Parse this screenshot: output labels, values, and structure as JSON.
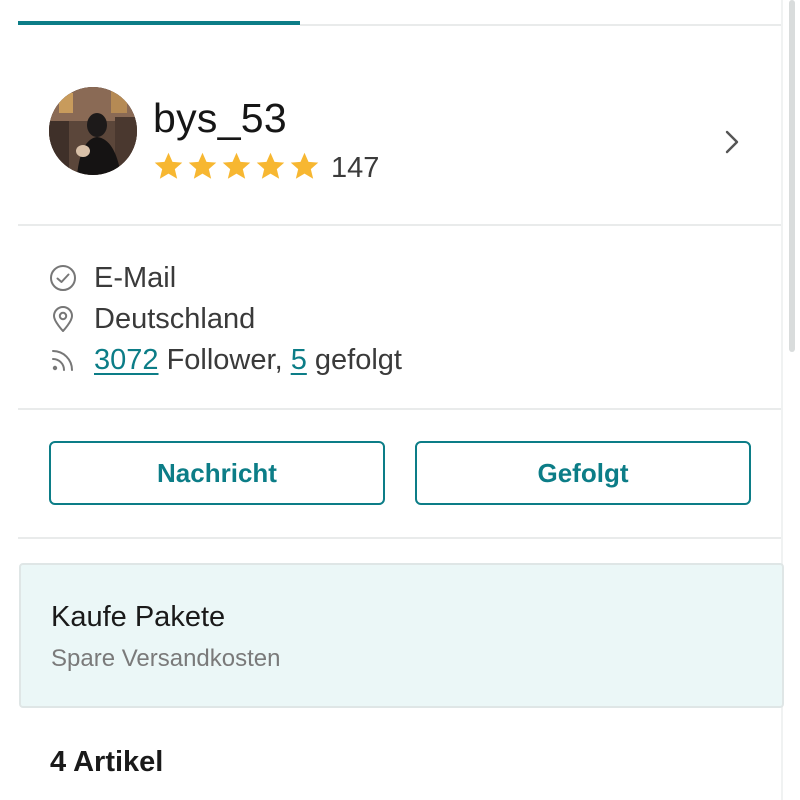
{
  "profile": {
    "username": "bys_53",
    "rating_stars": 5,
    "rating_count": "147"
  },
  "info": {
    "verified_label": "E-Mail",
    "location": "Deutschland",
    "followers_count": "3072",
    "followers_label": "Follower,",
    "following_count": "5",
    "following_label": "gefolgt"
  },
  "actions": {
    "message_label": "Nachricht",
    "follow_label": "Gefolgt"
  },
  "promo": {
    "title": "Kaufe Pakete",
    "subtitle": "Spare Versandkosten"
  },
  "items": {
    "count_label": "4 Artikel"
  },
  "colors": {
    "accent": "#0c7d87",
    "star": "#f7b731",
    "promo_bg": "#ebf7f7"
  },
  "icons": {
    "verified": "check-circle-icon",
    "location": "location-pin-icon",
    "followers": "rss-feed-icon",
    "open_profile": "chevron-right-icon"
  }
}
